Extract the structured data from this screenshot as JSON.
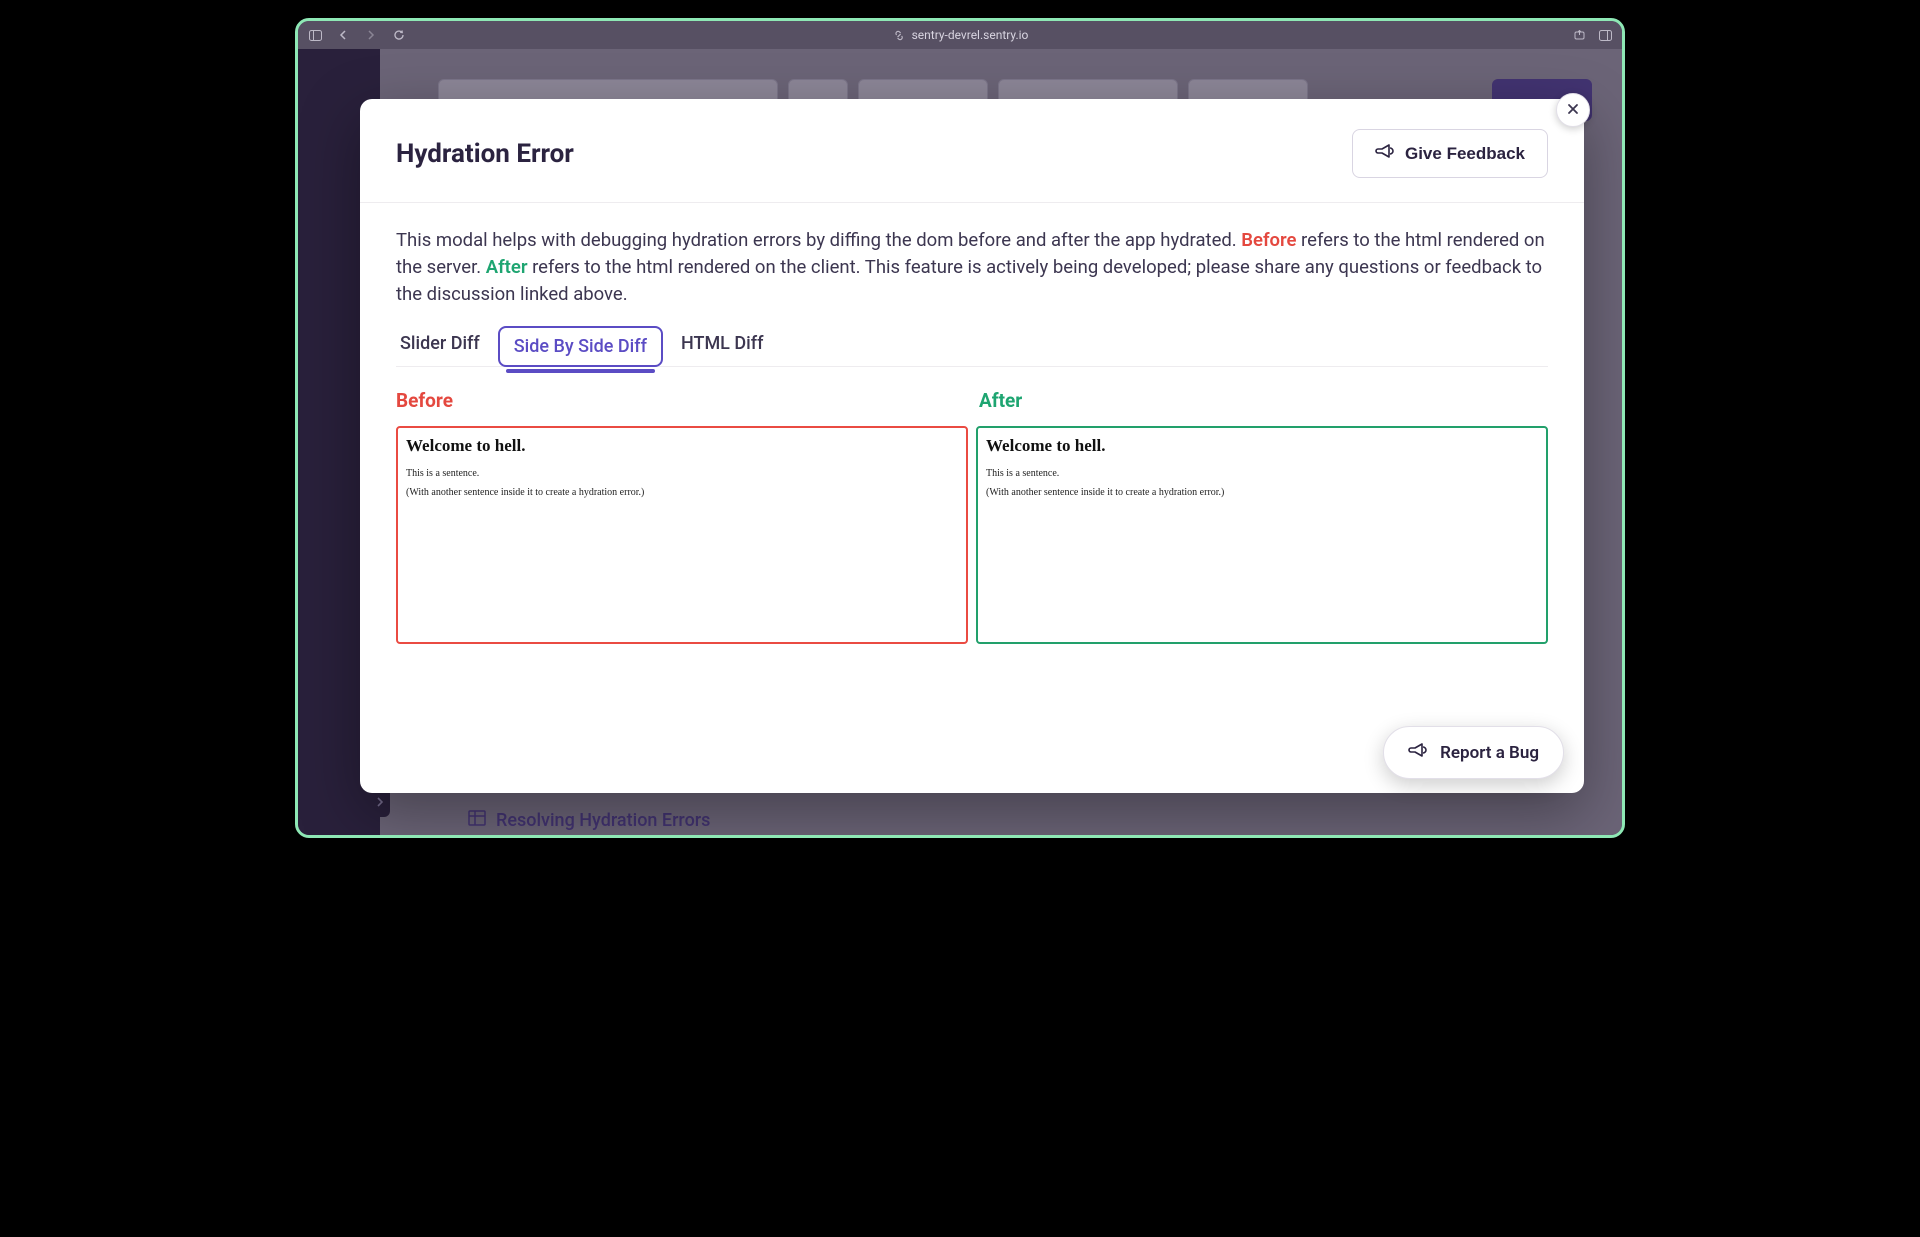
{
  "browser": {
    "url": "sentry-devrel.sentry.io"
  },
  "background": {
    "bottom_link": "Resolving Hydration Errors"
  },
  "modal": {
    "title": "Hydration Error",
    "feedback_button": "Give Feedback",
    "description": {
      "part1": "This modal helps with debugging hydration errors by diffing the dom before and after the app hydrated. ",
      "before_word": "Before",
      "part2": " refers to the html rendered on the server. ",
      "after_word": "After",
      "part3": " refers to the html rendered on the client. This feature is actively being developed; please share any questions or feedback to the discussion linked above."
    },
    "tabs": {
      "slider": "Slider Diff",
      "side_by_side": "Side By Side Diff",
      "html": "HTML Diff"
    },
    "labels": {
      "before": "Before",
      "after": "After"
    },
    "pane_before": {
      "heading": "Welcome to hell.",
      "line1": "This is a sentence.",
      "line2": "(With another sentence inside it to create a hydration error.)"
    },
    "pane_after": {
      "heading": "Welcome to hell.",
      "line1": "This is a sentence.",
      "line2": "(With another sentence inside it to create a hydration error.)"
    },
    "report_bug": "Report a Bug"
  }
}
